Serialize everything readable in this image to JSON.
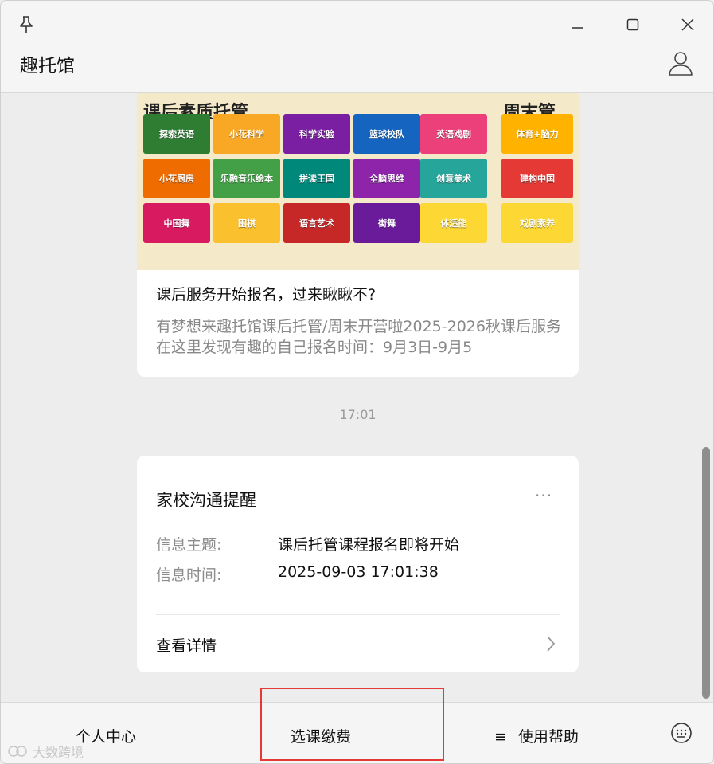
{
  "window": {
    "title": "趣托馆"
  },
  "article": {
    "banner": {
      "title_left": "课后素质托管",
      "title_right": "周末管",
      "tiles": [
        {
          "text": "探索英语",
          "color": "#2e7d32"
        },
        {
          "text": "小花科学",
          "color": "#f9a825"
        },
        {
          "text": "科学实验",
          "color": "#7b1fa2"
        },
        {
          "text": "篮球校队",
          "color": "#1565c0"
        },
        {
          "text": "英语戏剧",
          "color": "#ec407a"
        },
        {
          "text": "小花厨房",
          "color": "#ef6c00"
        },
        {
          "text": "乐融音乐绘本",
          "color": "#43a047"
        },
        {
          "text": "拼读王国",
          "color": "#00897b"
        },
        {
          "text": "全脑思维",
          "color": "#8e24aa"
        },
        {
          "text": "创意美术",
          "color": "#26a69a"
        },
        {
          "text": "中国舞",
          "color": "#d81b60"
        },
        {
          "text": "围棋",
          "color": "#fbc02d"
        },
        {
          "text": "语言艺术",
          "color": "#c62828"
        },
        {
          "text": "街舞",
          "color": "#6a1b9a"
        },
        {
          "text": "体适能",
          "color": "#fdd835"
        },
        {
          "text": "体育+脑力",
          "color": "#ffb300"
        },
        {
          "text": "建构中国",
          "color": "#e53935"
        },
        {
          "text": "戏剧素养",
          "color": "#fdd835"
        }
      ]
    },
    "title": "课后服务开始报名，过来瞅瞅不?",
    "desc": "有梦想来趣托馆课后托管/周末开营啦2025-2026秋课后服务在这里发现有趣的自己报名时间：9月3日-9月5"
  },
  "timestamp": "17:01",
  "notice": {
    "title": "家校沟通提醒",
    "more": "···",
    "subject_label": "信息主题:",
    "subject_value": "课后托管课程报名即将开始",
    "time_label": "信息时间:",
    "time_value": "2025-09-03 17:01:38",
    "detail_label": "查看详情"
  },
  "menu": {
    "item1": "个人中心",
    "item2": "选课缴费",
    "item3": "使用帮助",
    "item3_icon": "≡"
  },
  "watermark": "大数跨境"
}
